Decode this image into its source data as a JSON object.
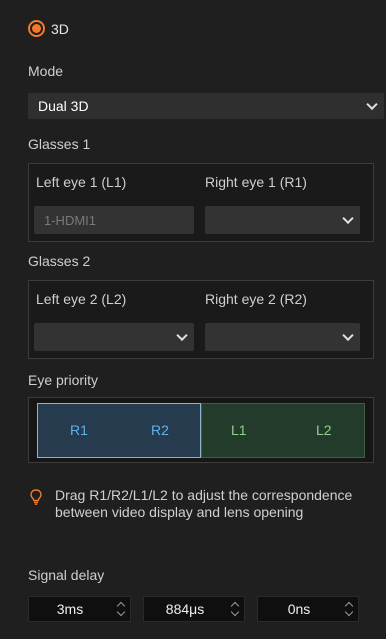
{
  "three_d": {
    "label": "3D",
    "checked": true
  },
  "mode": {
    "label": "Mode",
    "value": "Dual 3D"
  },
  "glasses1": {
    "label": "Glasses 1",
    "left_label": "Left eye 1 (L1)",
    "right_label": "Right eye 1 (R1)",
    "left_value": "1-HDMI1",
    "right_value": ""
  },
  "glasses2": {
    "label": "Glasses 2",
    "left_label": "Left eye 2 (L2)",
    "right_label": "Right eye 2 (R2)",
    "left_value": "",
    "right_value": ""
  },
  "eye_priority": {
    "label": "Eye priority",
    "items": [
      "R1",
      "R2",
      "L1",
      "L2"
    ]
  },
  "hint": "Drag R1/R2/L1/L2 to adjust the correspondence between video display and lens opening",
  "signal_delay": {
    "label": "Signal delay",
    "values": [
      "3ms",
      "884μs",
      "0ns"
    ]
  },
  "colors": {
    "accent": "#f27a2a",
    "priority_blue": "#263c4e",
    "priority_green": "#233b2a"
  }
}
